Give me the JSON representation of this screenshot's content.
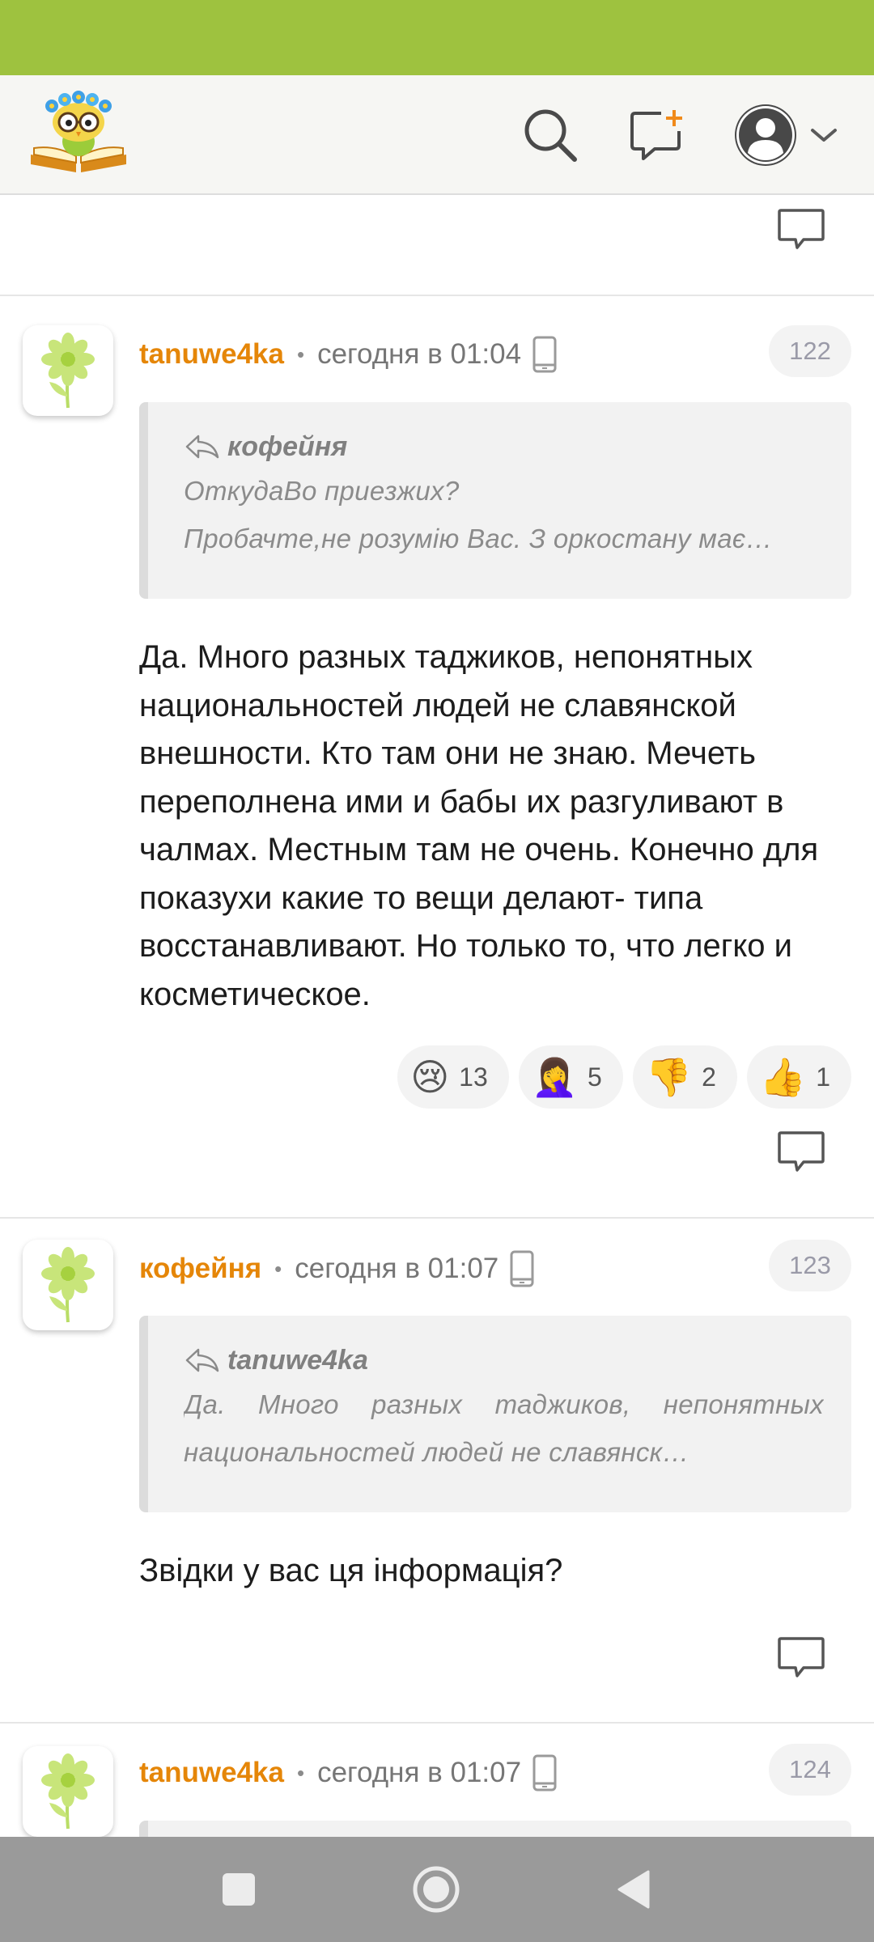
{
  "comments": [
    {
      "author": "tanuwe4ka",
      "time": "сегодня в 01:04",
      "number": "122",
      "quote": {
        "author": "кофейня",
        "line1": "ОткудаВо приезжих?",
        "line2": "Пробачте,не розумію Вас. З оркостану має…"
      },
      "body": "Да. Много разных таджиков, непонятных национальностей людей не славянской внешности. Кто там они не знаю. Мечеть переполнена ими и бабы их разгуливают в чалмах. Местным там не очень. Конечно для показухи какие то вещи делают- типа восстанавливают. Но только то, что легко и косметическое.",
      "reactions": [
        {
          "emoji": "😢",
          "count": "13"
        },
        {
          "emoji": "🤦‍♀️",
          "count": "5"
        },
        {
          "emoji": "👎",
          "count": "2"
        },
        {
          "emoji": "👍",
          "count": "1"
        }
      ]
    },
    {
      "author": "кофейня",
      "time": "сегодня в 01:07",
      "number": "123",
      "quote": {
        "author": "tanuwe4ka",
        "text": "Да. Много разных таджиков, непонятных национальностей людей не славянск…"
      },
      "body": "Звідки у вас ця інформація?"
    },
    {
      "author": "tanuwe4ka",
      "time": "сегодня в 01:07",
      "number": "124"
    }
  ],
  "colors": {
    "status_bar": "#9ec23f",
    "author": "#e58608",
    "nav_bar": "#9a9a9a"
  },
  "icons": {
    "logo": "owl-on-book-logo",
    "search": "search-icon",
    "new_post": "new-post-icon",
    "profile": "avatar-icon",
    "reply": "reply-bubble-icon",
    "device": "phone-icon"
  }
}
